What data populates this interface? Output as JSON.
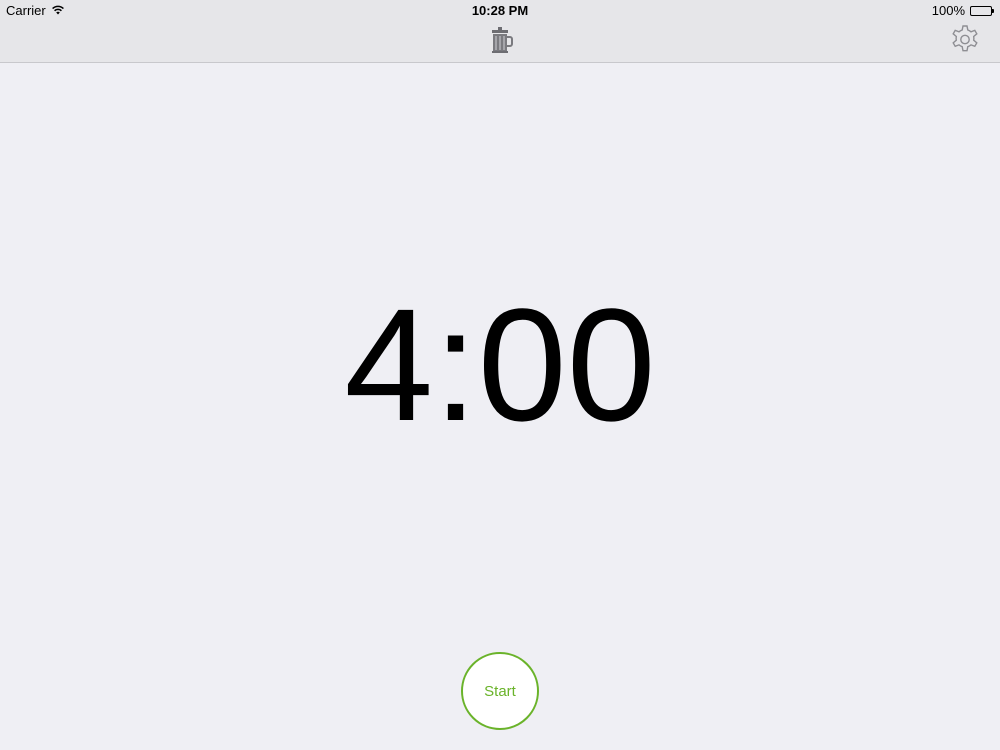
{
  "status_bar": {
    "carrier": "Carrier",
    "time": "10:28 PM",
    "battery_percent": "100%",
    "battery_level": 1.0
  },
  "nav": {
    "logo_icon": "french-press-icon",
    "settings_icon": "gear-icon"
  },
  "timer": {
    "display": "4:00"
  },
  "controls": {
    "start_label": "Start",
    "accent_color": "#6ab32a"
  }
}
